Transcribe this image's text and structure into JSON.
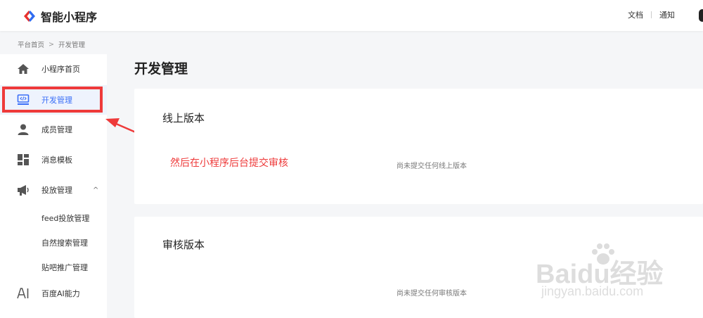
{
  "app": {
    "title": "智能小程序"
  },
  "header": {
    "links": [
      "文档",
      "通知"
    ]
  },
  "breadcrumb": [
    "平台首页",
    "开发管理"
  ],
  "sidebar": {
    "items": [
      {
        "label": "小程序首页",
        "icon": "home-icon"
      },
      {
        "label": "开发管理",
        "icon": "code-icon",
        "active": true
      },
      {
        "label": "成员管理",
        "icon": "user-icon"
      },
      {
        "label": "消息模板",
        "icon": "template-icon"
      },
      {
        "label": "投放管理",
        "icon": "megaphone-icon",
        "expanded": true
      },
      {
        "label": "百度AI能力",
        "icon": "ai-icon"
      }
    ],
    "sub_items": [
      "feed投放管理",
      "自然搜索管理",
      "贴吧推广管理"
    ]
  },
  "main": {
    "title": "开发管理",
    "cards": [
      {
        "title": "线上版本",
        "empty_text": "尚未提交任何线上版本"
      },
      {
        "title": "审核版本",
        "empty_text": "尚未提交任何审核版本"
      }
    ],
    "annotation": "然后在小程序后台提交审核"
  },
  "watermark": {
    "brand": "Baidu经验",
    "url": "jingyan.baidu.com"
  },
  "colors": {
    "accent": "#3a6ff7",
    "annotation": "#ee3a3a",
    "logo_red": "#e8312d",
    "logo_blue": "#2f6bf0"
  }
}
